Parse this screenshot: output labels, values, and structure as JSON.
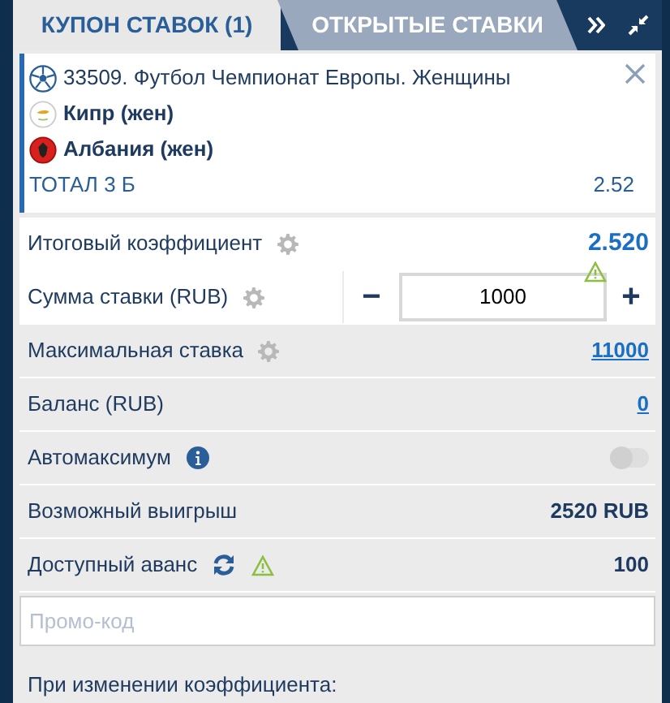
{
  "tabs": [
    {
      "label": "КУПОН СТАВОК (1)",
      "selected": true
    },
    {
      "label": "ОТКРЫТЫЕ СТАВКИ",
      "selected": false
    }
  ],
  "bet": {
    "event": "33509. Футбол Чемпионат Европы. Женщины",
    "teams": [
      {
        "name": "Кипр (жен)",
        "kind": "cyprus"
      },
      {
        "name": "Албания (жен)",
        "kind": "albania"
      }
    ],
    "market": "ТОТАЛ 3 Б",
    "odds": "2.52"
  },
  "rows": [
    {
      "kind": "odds",
      "label": "Итоговый коэффициент",
      "value": "2.520"
    },
    {
      "kind": "stake",
      "label": "Сумма ставки (RUB)",
      "value": "1000",
      "minus": "−",
      "plus": "+"
    },
    {
      "kind": "max",
      "label": "Максимальная ставка",
      "value": "11000"
    },
    {
      "kind": "link",
      "label": "Баланс (RUB)",
      "value": "0"
    },
    {
      "kind": "toggle",
      "label": "Автомаксимум",
      "on": false
    },
    {
      "kind": "value",
      "label": "Возможный выигрыш",
      "value": "2520 RUB"
    },
    {
      "kind": "advance",
      "label": "Доступный аванс",
      "value": "100"
    }
  ],
  "promo": {
    "placeholder": "Промо-код"
  },
  "footer": "При изменении коэффициента:"
}
